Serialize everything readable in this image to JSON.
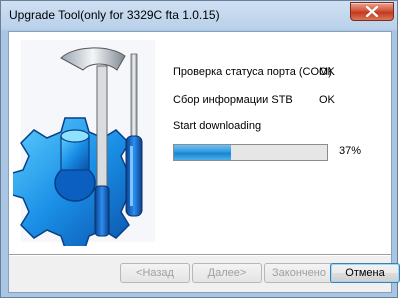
{
  "window": {
    "title": "Upgrade Tool(only for 3329C fta 1.0.15)"
  },
  "colors": {
    "progress_fill": "#2f9be0",
    "close_button": "#c8452a"
  },
  "icons": {
    "close": "close-icon",
    "illustration": "gear-wrench-screwdriver-icon"
  },
  "status": {
    "items": [
      {
        "label": "Проверка статуса порта (COM)",
        "result": "OK"
      },
      {
        "label": "Сбор информации STB",
        "result": "OK"
      },
      {
        "label": "Start downloading",
        "result": ""
      }
    ]
  },
  "progress": {
    "value": 0.37,
    "label": "37%"
  },
  "buttons": {
    "back": {
      "label": "<Назад",
      "enabled": false
    },
    "next": {
      "label": "Далее>",
      "enabled": false
    },
    "finish": {
      "label": "Закончено",
      "enabled": false
    },
    "cancel": {
      "label": "Отмена",
      "enabled": true
    }
  }
}
